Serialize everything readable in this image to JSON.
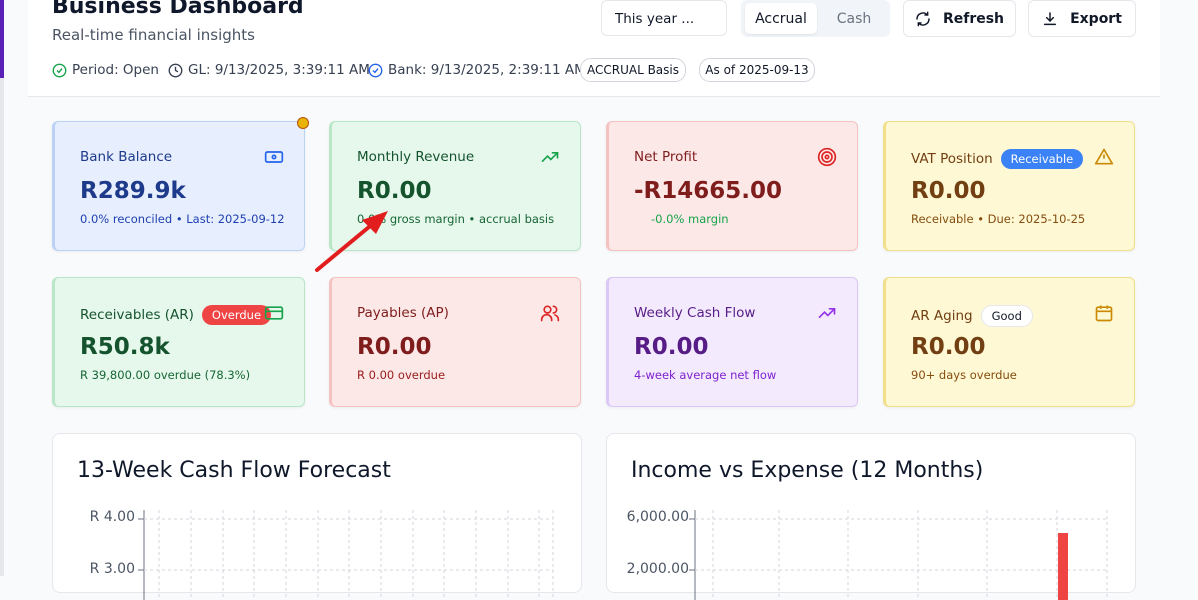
{
  "header": {
    "title": "Business Dashboard",
    "subtitle": "Real-time financial insights"
  },
  "status": {
    "period": "Period: Open",
    "gl": "GL: 9/13/2025, 3:39:11 AM",
    "bank": "Bank: 9/13/2025, 2:39:11 AM",
    "basis_pill": "ACCRUAL Basis",
    "asof_pill": "As of 2025-09-13"
  },
  "controls": {
    "period_select": "This year ...",
    "accrual": "Accrual",
    "cash": "Cash",
    "refresh": "Refresh",
    "export": "Export"
  },
  "cards": {
    "bank": {
      "label": "Bank Balance",
      "value": "R289.9k",
      "note": "0.0% reconciled • Last: 2025-09-12",
      "icon": "banknote-icon"
    },
    "revenue": {
      "label": "Monthly Revenue",
      "value": "R0.00",
      "note": "0.0% gross margin • accrual basis",
      "icon": "trending-up-icon"
    },
    "profit": {
      "label": "Net Profit",
      "value": "-R14665.00",
      "note": "-0.0% margin",
      "icon": "target-icon"
    },
    "vat": {
      "label": "VAT Position",
      "badge": "Receivable",
      "value": "R0.00",
      "note": "Receivable • Due: 2025-10-25",
      "icon": "alert-triangle-icon"
    },
    "ar": {
      "label": "Receivables (AR)",
      "badge": "Overdue",
      "value": "R50.8k",
      "note": "R 39,800.00 overdue (78.3%)",
      "icon": "credit-card-icon"
    },
    "ap": {
      "label": "Payables (AP)",
      "value": "R0.00",
      "note": "R 0.00 overdue",
      "icon": "users-icon"
    },
    "cashflow": {
      "label": "Weekly Cash Flow",
      "value": "R0.00",
      "note": "4-week average net flow",
      "icon": "trending-up-icon"
    },
    "aging": {
      "label": "AR Aging",
      "badge": "Good",
      "value": "R0.00",
      "note": "90+ days overdue",
      "icon": "calendar-icon"
    }
  },
  "charts": {
    "forecast": {
      "title": "13-Week Cash Flow Forecast",
      "yticks": [
        "R 4.00",
        "R 3.00"
      ]
    },
    "income": {
      "title": "Income vs Expense (12 Months)",
      "yticks": [
        "6,000.00",
        "2,000.00"
      ]
    }
  },
  "colors": {
    "accent_purple": "#5b21b6",
    "blue_card": "#e7efff",
    "green_card": "#e6f8ec",
    "red_card": "#fde8e8",
    "yellow_card": "#fef8d4",
    "purple_card": "#f3eafe",
    "annotation_arrow": "#e11d1d"
  }
}
